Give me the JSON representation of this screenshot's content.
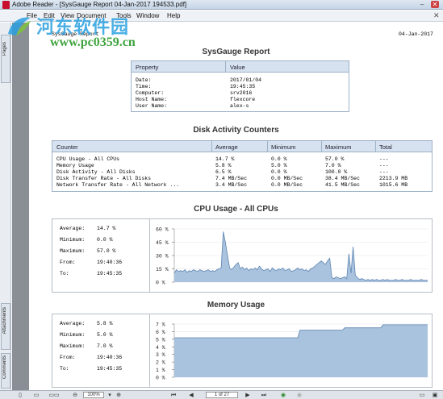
{
  "window": {
    "title": "Adobe Reader - [SysGauge Report 04-Jan-2017 194533.pdf]",
    "min_glyph": "–",
    "close_glyph": "✕"
  },
  "menu": {
    "items": [
      "File",
      "Edit",
      "View",
      "Document",
      "Tools",
      "Window",
      "Help"
    ],
    "close_glyph": "✕"
  },
  "watermark": {
    "cn_text": "河东软件园",
    "url": "www.pc0359.cn"
  },
  "nav": {
    "tabs": [
      "Pages",
      "Attachments",
      "Comments"
    ]
  },
  "report": {
    "header_left": "SysGauge Report",
    "header_right": "04-Jan-2017",
    "title": "SysGauge Report",
    "props_table": {
      "headers": [
        "Property",
        "Value"
      ],
      "labels": "Date:\nTime:\nComputer:\nHost Name:\nUser Name:",
      "values": "2017/01/04\n19:45:35\nsrv2016\nflexcore\nalex-s"
    },
    "disk_title": "Disk Activity Counters",
    "disk_table": {
      "headers": [
        "Counter",
        "Average",
        "Minimum",
        "Maximum",
        "Total"
      ],
      "col_counter": "CPU Usage - All CPUs\nMemory Usage\nDisk Activity - All Disks\nDisk Transfer Rate - All Disks\nNetwork Transfer Rate - All Network ...",
      "col_average": "14.7 %\n5.8 %\n6.5 %\n7.4 MB/Sec\n3.4 MB/Sec",
      "col_minimum": "0.0 %\n5.0 %\n0.0 %\n0.0 MB/Sec\n0.0 MB/Sec",
      "col_maximum": "57.0 %\n7.0 %\n100.0 %\n38.4 MB/Sec\n41.5 MB/Sec",
      "col_total": "---\n---\n---\n2213.9 MB\n1015.6 MB"
    },
    "cpu": {
      "title": "CPU Usage - All CPUs",
      "stats": [
        {
          "label": "Average:",
          "value": "14.7 %"
        },
        {
          "label": "Minimum:",
          "value": "0.0 %"
        },
        {
          "label": "Maximum:",
          "value": "57.0 %"
        },
        {
          "label": "From:",
          "value": "19:40:36"
        },
        {
          "label": "To:",
          "value": "19:45:35"
        }
      ]
    },
    "memory": {
      "title": "Memory Usage",
      "stats": [
        {
          "label": "Average:",
          "value": "5.8 %"
        },
        {
          "label": "Minimum:",
          "value": "5.0 %"
        },
        {
          "label": "Maximum:",
          "value": "7.0 %"
        },
        {
          "label": "From:",
          "value": "19:40:36"
        },
        {
          "label": "To:",
          "value": "19:45:35"
        }
      ]
    }
  },
  "chart_data": [
    {
      "type": "area",
      "title": "CPU Usage - All CPUs",
      "yticks": [
        "60 %",
        "45 %",
        "30 %",
        "15 %",
        "0 %"
      ],
      "ylim": [
        0,
        60
      ],
      "y": [
        10,
        14,
        12,
        13,
        12,
        14,
        11,
        13,
        12,
        14,
        13,
        12,
        14,
        13,
        12,
        13,
        14,
        12,
        13,
        12,
        14,
        15,
        16,
        57,
        45,
        30,
        16,
        14,
        17,
        20,
        22,
        15,
        17,
        14,
        16,
        13,
        15,
        14,
        16,
        14,
        18,
        15,
        13,
        14,
        15,
        12,
        16,
        14,
        13,
        15,
        14,
        16,
        13,
        14,
        15,
        12,
        13,
        14,
        16,
        14,
        15,
        13,
        14,
        12,
        15,
        16,
        18,
        20,
        22,
        24,
        22,
        20,
        24,
        27,
        5,
        4,
        6,
        5,
        4,
        5,
        6,
        4,
        32,
        10,
        40,
        8,
        5,
        3,
        4,
        3,
        2,
        3,
        2,
        3,
        2,
        3,
        2,
        2,
        3,
        2,
        3,
        2,
        2,
        2,
        3,
        2,
        2,
        3,
        2,
        2,
        2,
        3,
        2,
        2,
        2,
        2,
        3,
        2,
        2,
        2
      ]
    },
    {
      "type": "area",
      "title": "Memory Usage",
      "yticks": [
        "7 %",
        "6 %",
        "5 %",
        "4 %",
        "3 %",
        "2 %",
        "1 %",
        "0 %"
      ],
      "ylim": [
        0,
        7
      ],
      "y": [
        5.2,
        5.2,
        5.2,
        5.2,
        5.2,
        5.2,
        5.2,
        5.2,
        5.2,
        5.2,
        5.2,
        5.2,
        5.2,
        5.2,
        5.2,
        5.2,
        5.2,
        5.2,
        5.2,
        5.2,
        5.2,
        5.2,
        5.2,
        5.2,
        5.2,
        5.2,
        5.2,
        5.2,
        5.2,
        5.2,
        5.2,
        5.2,
        5.2,
        5.2,
        5.2,
        5.2,
        5.2,
        5.2,
        5.2,
        5.2,
        5.2,
        5.2,
        5.2,
        5.2,
        5.2,
        5.2,
        5.2,
        5.2,
        5.2,
        5.2,
        5.2,
        5.2,
        5.2,
        5.2,
        5.2,
        5.2,
        5.2,
        5.2,
        5.2,
        6.2,
        6.2,
        6.2,
        6.2,
        6.2,
        6.2,
        6.2,
        6.2,
        6.2,
        6.2,
        6.2,
        6.2,
        6.2,
        6.2,
        6.2,
        6.2,
        6.2,
        6.2,
        6.2,
        6.2,
        6.2,
        6.5,
        6.5,
        6.5,
        6.5,
        6.5,
        6.5,
        6.5,
        6.5,
        6.5,
        6.5,
        6.5,
        6.5,
        6.5,
        6.5,
        6.5,
        6.5,
        6.5,
        6.5,
        6.9,
        6.9,
        6.9,
        6.9,
        6.9,
        6.9,
        6.9,
        6.9,
        6.9,
        6.9,
        6.9,
        6.9,
        6.9,
        6.9,
        6.9,
        6.9,
        6.9,
        6.9,
        6.9,
        6.9,
        6.9,
        6.9
      ]
    }
  ],
  "statusbar": {
    "zoom": "100%",
    "page": "1 of 27"
  }
}
